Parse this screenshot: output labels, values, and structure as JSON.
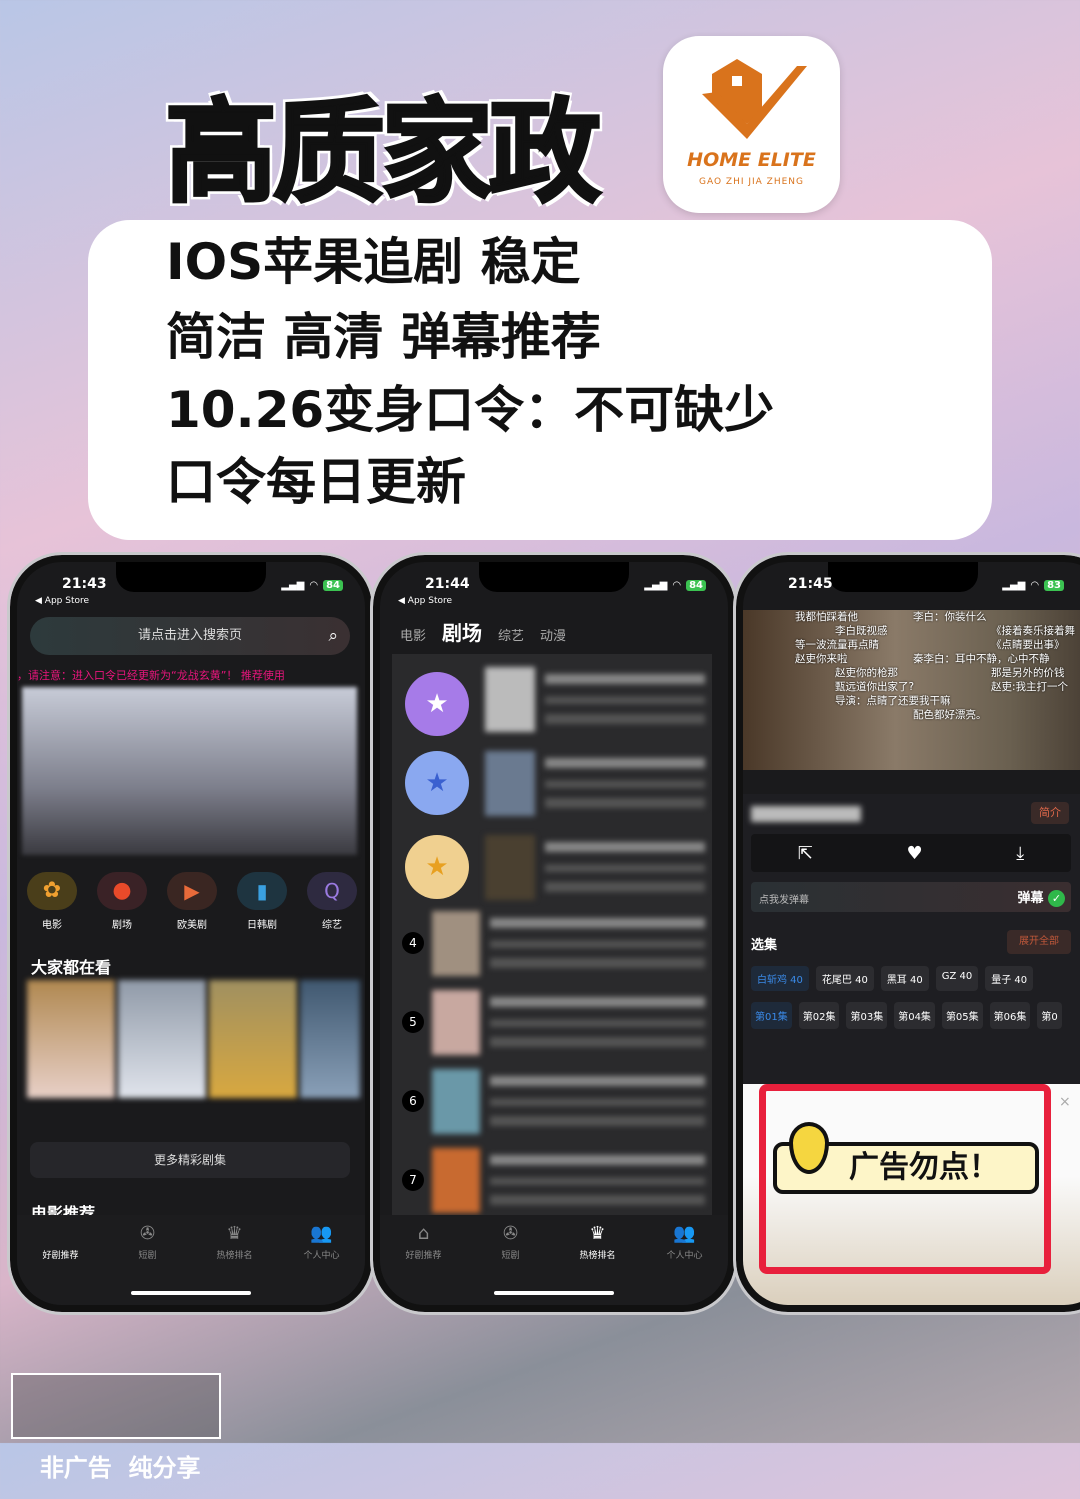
{
  "headline": "高质家政",
  "logo": {
    "brand": "HOME ELITE",
    "sub": "GAO ZHI JIA ZHENG",
    "color": "#d9731c"
  },
  "card_lines": [
    "IOS苹果追剧 稳定",
    "简洁 高清 弹幕推荐",
    "10.26变身口令：不可缺少",
    "口令每日更新"
  ],
  "phone1": {
    "time": "21:43",
    "back": "◀ App Store",
    "battery": "84",
    "search_placeholder": "请点击进入搜索页",
    "marquee": "，请注意：进入口令已经更新为“龙战玄黄”！    推荐使用",
    "categories": [
      "电影",
      "剧场",
      "欧美剧",
      "日韩剧",
      "综艺"
    ],
    "section1": "大家都在看",
    "more": "更多精彩剧集",
    "section2": "电影推荐",
    "tabs": [
      "好剧推荐",
      "短剧",
      "热榜排名",
      "个人中心"
    ]
  },
  "phone2": {
    "time": "21:44",
    "back": "◀ App Store",
    "battery": "84",
    "top_tabs": [
      "电影",
      "剧场",
      "综艺",
      "动漫"
    ],
    "active_tab": "剧场",
    "ranks": [
      "4",
      "5",
      "6",
      "7"
    ],
    "tabs": [
      "好剧推荐",
      "短剧",
      "热榜排名",
      "个人中心"
    ],
    "active_bottom": "热榜排名"
  },
  "phone3": {
    "time": "21:45",
    "battery": "83",
    "danmaku": [
      "我都怕踩着他",
      "李白：你装什么",
      "李白既视感",
      "《接着奏乐接着舞",
      "等一波流量再点睛",
      "《点睛要出事》",
      "赵吏你来啦",
      "秦李白：耳中不静，心中不静",
      "赵吏你的枪那",
      "那是另外的价钱",
      "甄远道你出家了?",
      "赵吏:我主打一个",
      "导演：点睛了还要我干嘛",
      "配色都好漂亮。"
    ],
    "intro": "简介",
    "danmaku_input": "点我发弹幕",
    "danmaku_toggle": "弹幕",
    "episodes_title": "选集",
    "expand": "展开全部",
    "sources": [
      "白斩鸡 40",
      "花尾巴 40",
      "黑耳 40",
      "GZ 40",
      "量子 40"
    ],
    "episodes": [
      "第01集",
      "第02集",
      "第03集",
      "第04集",
      "第05集",
      "第06集",
      "第0"
    ],
    "ad_warning": "广告勿点！"
  },
  "footer_badge": "非广告  纯分享"
}
